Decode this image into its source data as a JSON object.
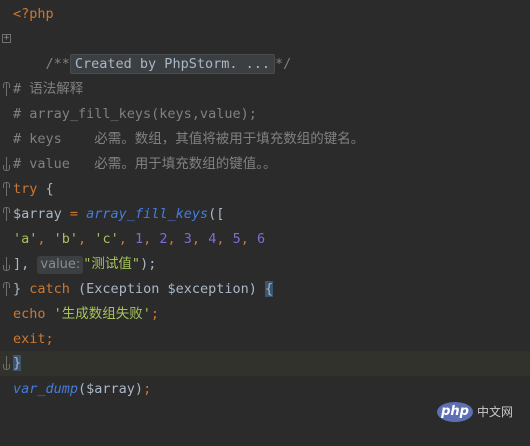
{
  "editor": {
    "lines": {
      "l1": {
        "open_tag": "<?php"
      },
      "l2": {
        "comment_open": "/**",
        "collapsed_text": "Created by PhpStorm. ...",
        "comment_close": "*/"
      },
      "l4": {
        "text": "# 语法解释"
      },
      "l5": {
        "text": "# array_fill_keys(keys,value);"
      },
      "l6": {
        "text": "# keys    必需。数组，其值将被用于填充数组的键名。"
      },
      "l7": {
        "text": "# value   必需。用于填充数组的键值。。"
      },
      "l8": {
        "kw": "try",
        "brace": " {"
      },
      "l9": {
        "var": "$array",
        "eq": " = ",
        "fn": "array_fill_keys",
        "open": "(["
      },
      "l10": {
        "s1": "'a'",
        "s2": "'b'",
        "s3": "'c'",
        "n1": "1",
        "n2": "2",
        "n3": "3",
        "n4": "4",
        "n5": "5",
        "n6": "6",
        "comma": ", "
      },
      "l11": {
        "close": "],",
        "hint": "value:",
        "str": "\"测试值\"",
        "end": ");"
      },
      "l12": {
        "brace_close": "}",
        "kw": "catch",
        "params": " (Exception $exception) ",
        "brace_open": "{"
      },
      "l13": {
        "kw": "echo",
        "str": " '生成数组失败'",
        "semi": ";"
      },
      "l14": {
        "kw": "exit",
        "semi": ";"
      },
      "l15": {
        "brace": "}"
      },
      "l16": {
        "fn": "var_dump",
        "args": "($array)",
        "semi": ";"
      }
    }
  },
  "watermark": {
    "logo": "php",
    "text": "中文网"
  }
}
